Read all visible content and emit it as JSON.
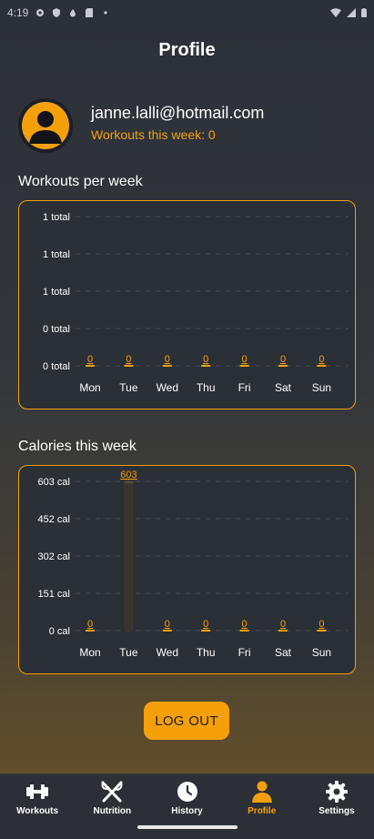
{
  "status_bar": {
    "time": "4:19"
  },
  "header": {
    "title": "Profile"
  },
  "user": {
    "email": "janne.lalli@hotmail.com",
    "workouts_this_week": "Workouts this week: 0"
  },
  "sections": {
    "workouts_title": "Workouts per week",
    "calories_title": "Calories this week"
  },
  "logout_label": "LOG OUT",
  "colors": {
    "accent": "#f5a009",
    "panel": "#2b2f36",
    "grid": "#4a4d52"
  },
  "chart_data": [
    {
      "type": "bar",
      "title": "Workouts per week",
      "categories": [
        "Mon",
        "Tue",
        "Wed",
        "Thu",
        "Fri",
        "Sat",
        "Sun"
      ],
      "values": [
        0,
        0,
        0,
        0,
        0,
        0,
        0
      ],
      "value_labels": [
        "0",
        "0",
        "0",
        "0",
        "0",
        "0",
        "0"
      ],
      "y_tick_labels": [
        "1 total",
        "1 total",
        "1 total",
        "0 total",
        "0 total"
      ],
      "ylim": [
        0,
        1
      ],
      "grid": true
    },
    {
      "type": "bar",
      "title": "Calories this week",
      "categories": [
        "Mon",
        "Tue",
        "Wed",
        "Thu",
        "Fri",
        "Sat",
        "Sun"
      ],
      "values": [
        0,
        603,
        0,
        0,
        0,
        0,
        0
      ],
      "value_labels": [
        "0",
        "603",
        "0",
        "0",
        "0",
        "0",
        "0"
      ],
      "y_tick_labels": [
        "603 cal",
        "452 cal",
        "302 cal",
        "151 cal",
        "0 cal"
      ],
      "ylim": [
        0,
        603
      ],
      "grid": true
    }
  ],
  "nav": [
    {
      "label": "Workouts",
      "icon": "dumbbell-icon",
      "active": false
    },
    {
      "label": "Nutrition",
      "icon": "fork-knife-icon",
      "active": false
    },
    {
      "label": "History",
      "icon": "clock-icon",
      "active": false
    },
    {
      "label": "Profile",
      "icon": "person-icon",
      "active": true
    },
    {
      "label": "Settings",
      "icon": "gear-icon",
      "active": false
    }
  ]
}
